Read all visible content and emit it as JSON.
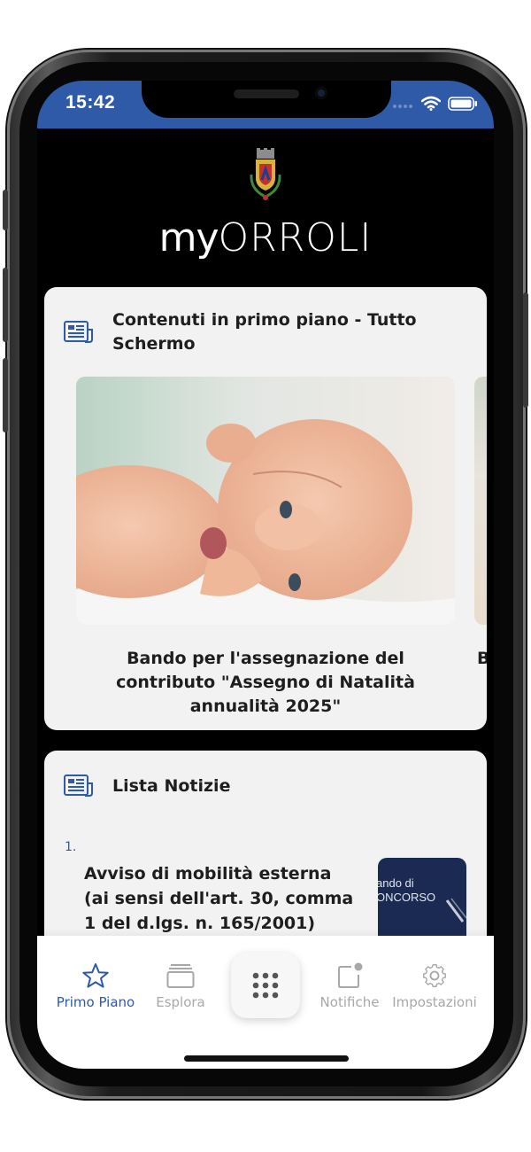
{
  "status_bar": {
    "time": "15:42"
  },
  "header": {
    "title_part1": "MY",
    "title_part2": "ORROLI"
  },
  "featured": {
    "title": "Contenuti in primo piano - Tutto Schermo",
    "slide_caption": "Bando per l'assegnazione del contributo \"Assegno di Natalità annualità 2025\"",
    "next_caption_peek": "B"
  },
  "news": {
    "title": "Lista Notizie",
    "items": [
      {
        "number": "1.",
        "text": "Avviso di mobilità esterna (ai sensi dell'art. 30, comma 1 del d.lgs. n. 165/2001)",
        "thumb_line1": "ando di",
        "thumb_line2": "ONCORSO"
      }
    ]
  },
  "tab_bar": {
    "items": [
      {
        "label": "Primo Piano",
        "icon": "star-icon",
        "active": true
      },
      {
        "label": "Esplora",
        "icon": "stack-icon",
        "active": false
      },
      {
        "label": "Notifiche",
        "icon": "notification-icon",
        "active": false
      },
      {
        "label": "Impostazioni",
        "icon": "gear-icon",
        "active": false
      }
    ],
    "center_icon": "grid-dots-icon"
  },
  "colors": {
    "accent": "#2e5aa8",
    "background": "#000000",
    "card": "#f2f2f2",
    "inactive": "#a8a8a8"
  }
}
